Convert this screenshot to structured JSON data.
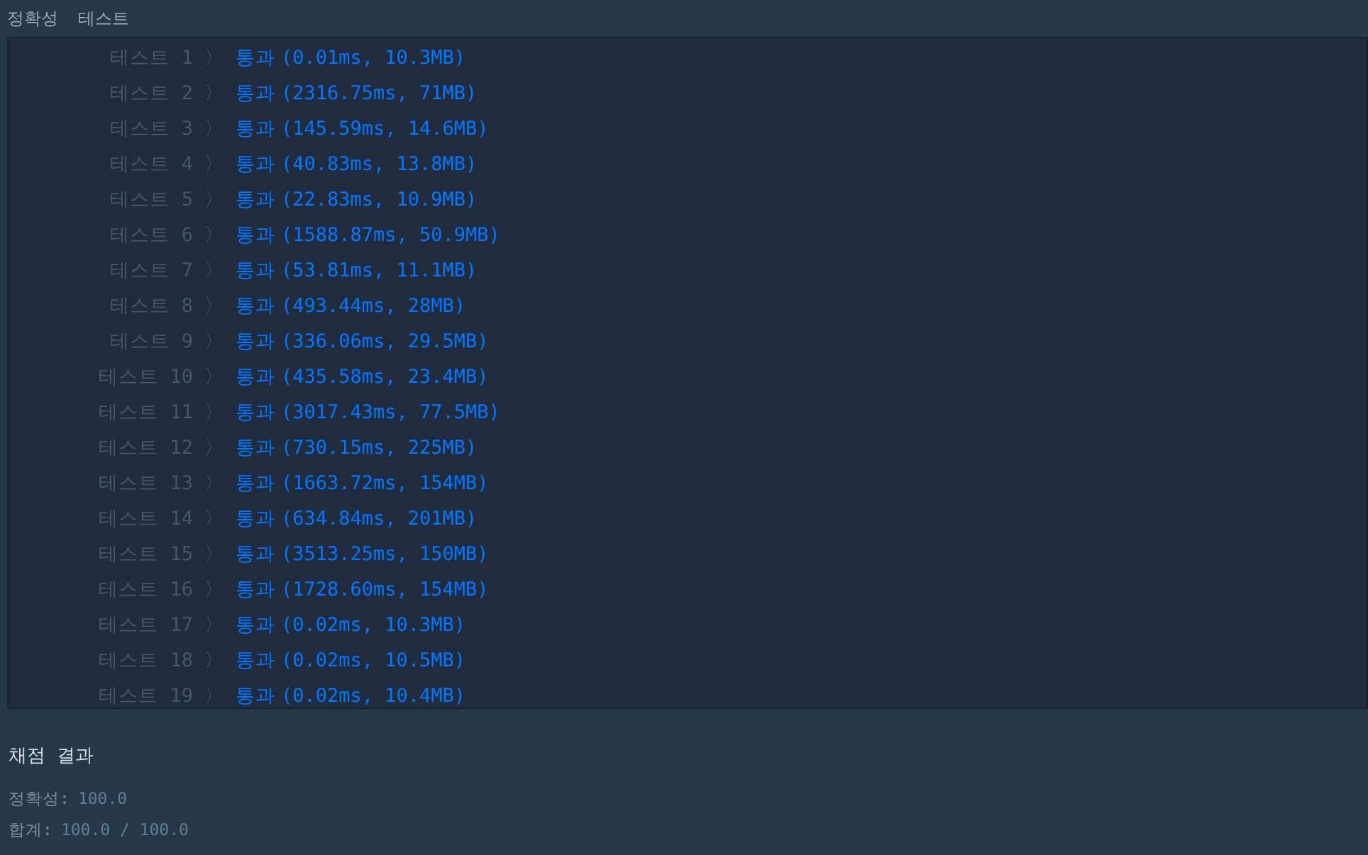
{
  "header": [
    "정확성",
    "테스트"
  ],
  "tests": [
    {
      "label": "테스트 1",
      "chevron": "〉",
      "passed": true,
      "result": "통과",
      "detail": "(0.01ms, 10.3MB)"
    },
    {
      "label": "테스트 2",
      "chevron": "〉",
      "passed": true,
      "result": "통과",
      "detail": "(2316.75ms, 71MB)"
    },
    {
      "label": "테스트 3",
      "chevron": "〉",
      "passed": true,
      "result": "통과",
      "detail": "(145.59ms, 14.6MB)"
    },
    {
      "label": "테스트 4",
      "chevron": "〉",
      "passed": true,
      "result": "통과",
      "detail": "(40.83ms, 13.8MB)"
    },
    {
      "label": "테스트 5",
      "chevron": "〉",
      "passed": true,
      "result": "통과",
      "detail": "(22.83ms, 10.9MB)"
    },
    {
      "label": "테스트 6",
      "chevron": "〉",
      "passed": true,
      "result": "통과",
      "detail": "(1588.87ms, 50.9MB)"
    },
    {
      "label": "테스트 7",
      "chevron": "〉",
      "passed": true,
      "result": "통과",
      "detail": "(53.81ms, 11.1MB)"
    },
    {
      "label": "테스트 8",
      "chevron": "〉",
      "passed": true,
      "result": "통과",
      "detail": "(493.44ms, 28MB)"
    },
    {
      "label": "테스트 9",
      "chevron": "〉",
      "passed": true,
      "result": "통과",
      "detail": "(336.06ms, 29.5MB)"
    },
    {
      "label": "테스트 10",
      "chevron": "〉",
      "passed": true,
      "result": "통과",
      "detail": "(435.58ms, 23.4MB)"
    },
    {
      "label": "테스트 11",
      "chevron": "〉",
      "passed": true,
      "result": "통과",
      "detail": "(3017.43ms, 77.5MB)"
    },
    {
      "label": "테스트 12",
      "chevron": "〉",
      "passed": true,
      "result": "통과",
      "detail": "(730.15ms, 225MB)"
    },
    {
      "label": "테스트 13",
      "chevron": "〉",
      "passed": true,
      "result": "통과",
      "detail": "(1663.72ms, 154MB)"
    },
    {
      "label": "테스트 14",
      "chevron": "〉",
      "passed": true,
      "result": "통과",
      "detail": "(634.84ms, 201MB)"
    },
    {
      "label": "테스트 15",
      "chevron": "〉",
      "passed": true,
      "result": "통과",
      "detail": "(3513.25ms, 150MB)"
    },
    {
      "label": "테스트 16",
      "chevron": "〉",
      "passed": true,
      "result": "통과",
      "detail": "(1728.60ms, 154MB)"
    },
    {
      "label": "테스트 17",
      "chevron": "〉",
      "passed": true,
      "result": "통과",
      "detail": "(0.02ms, 10.3MB)"
    },
    {
      "label": "테스트 18",
      "chevron": "〉",
      "passed": true,
      "result": "통과",
      "detail": "(0.02ms, 10.5MB)"
    },
    {
      "label": "테스트 19",
      "chevron": "〉",
      "passed": true,
      "result": "통과",
      "detail": "(0.02ms, 10.4MB)"
    }
  ],
  "summary": {
    "title": "채점 결과",
    "lines": [
      {
        "label": "정확성:",
        "value": "100.0"
      },
      {
        "label": "합계:",
        "value": "100.0 / 100.0"
      }
    ]
  }
}
